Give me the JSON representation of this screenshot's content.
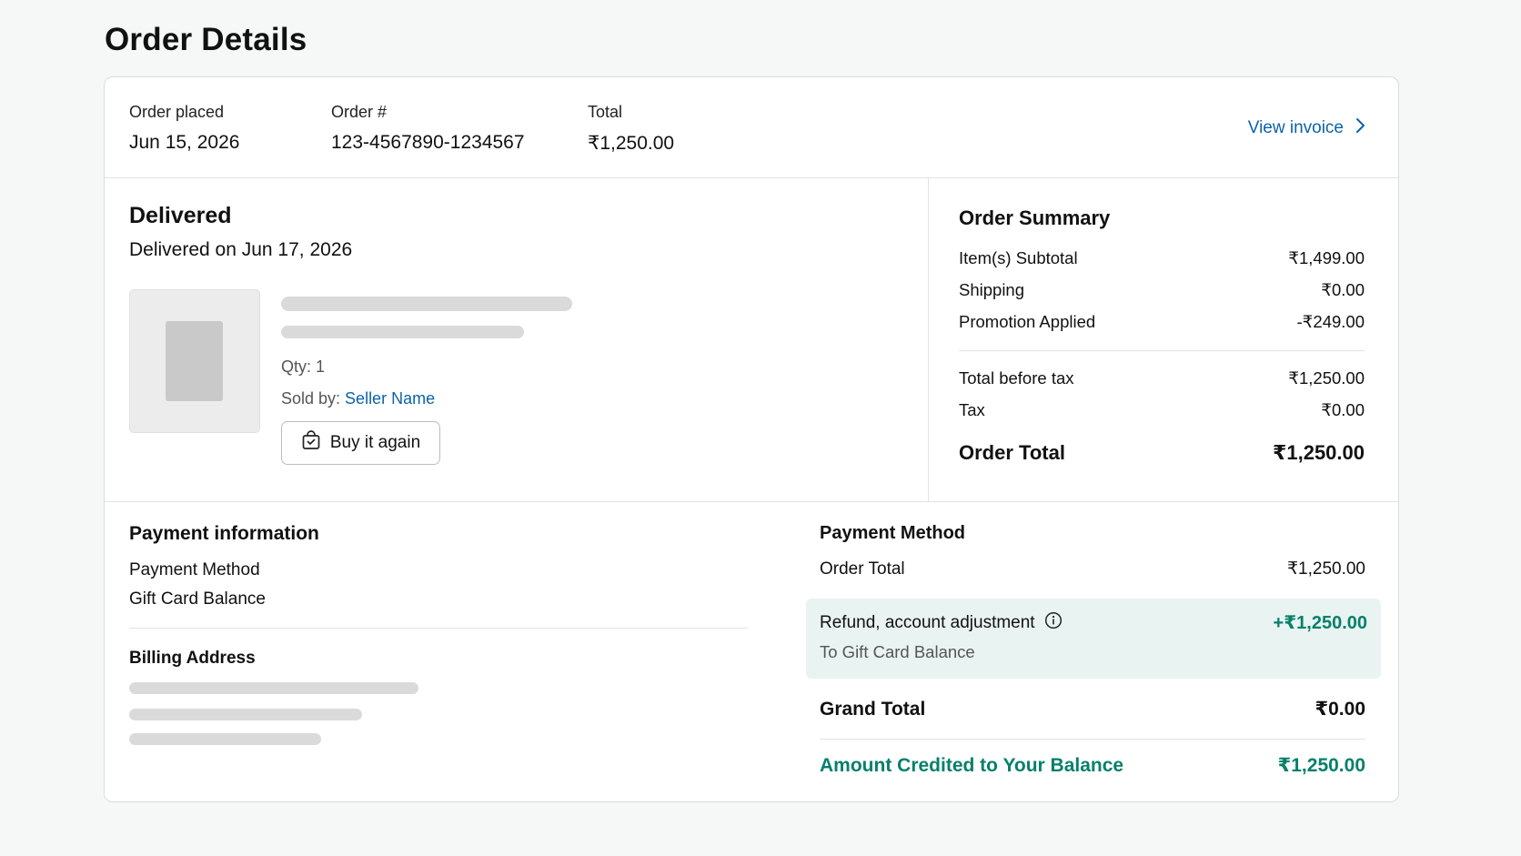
{
  "page": {
    "title": "Order Details"
  },
  "header": {
    "order_placed_label": "Order placed",
    "order_placed_value": "Jun 15, 2026",
    "order_number_label": "Order #",
    "order_number_value": "123-4567890-1234567",
    "total_label": "Total",
    "total_value": "₹1,250.00",
    "view_invoice": "View invoice"
  },
  "shipment": {
    "status": "Delivered",
    "delivered_on": "Delivered on Jun 17, 2026",
    "item": {
      "qty": "Qty: 1",
      "sold_by_label": "Sold by: ",
      "seller_name": "Seller Name",
      "buy_again": "Buy it again"
    }
  },
  "summary": {
    "title": "Order Summary",
    "rows": [
      {
        "label": "Item(s) Subtotal",
        "value": "₹1,499.00"
      },
      {
        "label": "Shipping",
        "value": "₹0.00"
      },
      {
        "label": "Promotion Applied",
        "value": "-₹249.00"
      },
      {
        "label": "Total before tax",
        "value": "₹1,250.00"
      },
      {
        "label": "Tax",
        "value": "₹0.00"
      }
    ],
    "order_total_label": "Order Total",
    "order_total_value": "₹1,250.00"
  },
  "payment_info": {
    "title": "Payment information",
    "method_label": "Payment Method",
    "method_value": "Gift Card Balance",
    "billing_title": "Billing Address"
  },
  "payment_method": {
    "title": "Payment Method",
    "order_total_label": "Order Total",
    "order_total_value": "₹1,250.00",
    "refund_label": "Refund, account adjustment",
    "refund_value": "+₹1,250.00",
    "refund_sub": "To Gift Card Balance",
    "grand_total_label": "Grand Total",
    "grand_total_value": "₹0.00",
    "credited_label": "Amount Credited to Your Balance",
    "credited_value": "₹1,250.00"
  },
  "colors": {
    "link": "#0b63a8",
    "positive": "#06806a",
    "refund_bg": "#e9f3f1"
  },
  "icons": [
    "chevron-right-icon",
    "shopping-bag-icon",
    "info-icon"
  ]
}
